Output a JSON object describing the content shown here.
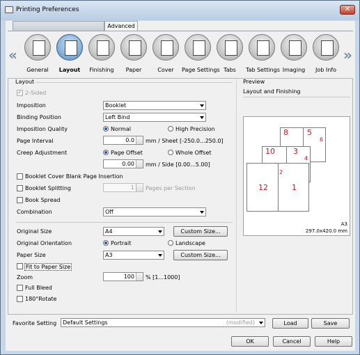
{
  "window": {
    "title": "Printing Preferences",
    "close_glyph": "✕"
  },
  "tabs": {
    "advanced": "Advanced"
  },
  "features": [
    {
      "label": "General",
      "icon": "printer-icon"
    },
    {
      "label": "Layout",
      "icon": "layout-icon"
    },
    {
      "label": "Finishing",
      "icon": "finishing-icon"
    },
    {
      "label": "Paper",
      "icon": "paper-icon"
    },
    {
      "label": "Cover",
      "icon": "cover-icon"
    },
    {
      "label": "Page Settings",
      "icon": "page-settings-icon"
    },
    {
      "label": "Tabs",
      "icon": "tabs-icon"
    },
    {
      "label": "Tab Settings",
      "icon": "tab-settings-icon"
    },
    {
      "label": "Imaging",
      "icon": "imaging-icon"
    },
    {
      "label": "Job Info",
      "icon": "job-info-icon"
    }
  ],
  "layout": {
    "group_title": "Layout",
    "two_sided": "2-Sided",
    "imposition_label": "Imposition",
    "imposition_value": "Booklet",
    "binding_label": "Binding Position",
    "binding_value": "Left Bind",
    "quality_label": "Imposition Quality",
    "quality_normal": "Normal",
    "quality_high": "High Precision",
    "page_interval_label": "Page Interval",
    "page_interval_value": "0.0",
    "page_interval_unit": "mm / Sheet [-250.0...250.0]",
    "creep_label": "Creep Adjustment",
    "creep_page_offset": "Page Offset",
    "creep_whole_offset": "Whole Offset",
    "creep_value": "0.00",
    "creep_unit": "mm / Side [0.00...5.00]",
    "booklet_cover": "Booklet Cover Blank Page Insertion",
    "booklet_split": "Booklet Splitting",
    "split_value": "1",
    "split_unit": "Pages per Section",
    "book_spread": "Book Spread",
    "combination_label": "Combination",
    "combination_value": "Off",
    "orig_size_label": "Original Size",
    "orig_size_value": "A4",
    "custom_size": "Custom Size...",
    "orientation_label": "Original Orientation",
    "portrait": "Portrait",
    "landscape": "Landscape",
    "paper_size_label": "Paper Size",
    "paper_size_value": "A3",
    "fit_to_paper": "Fit to Paper Size",
    "zoom_label": "Zoom",
    "zoom_value": "100",
    "zoom_unit": "% [1...1000]",
    "full_bleed": "Full Bleed",
    "rotate": "180°Rotate"
  },
  "preview": {
    "group_title": "Preview",
    "subtitle": "Layout and Finishing",
    "paper": "A3",
    "dims": "297.0x420.0 mm",
    "page_numbers": [
      "8",
      "5",
      "6",
      "10",
      "3",
      "4",
      "12",
      "1",
      "2"
    ]
  },
  "favorite": {
    "label": "Favorite Setting",
    "value": "Default Settings",
    "status": "(modified)",
    "load": "Load",
    "save": "Save"
  },
  "buttons": {
    "ok": "OK",
    "cancel": "Cancel",
    "help": "Help"
  },
  "colors": {
    "accent": "#2c5a9e",
    "page_number": "#b1202a"
  }
}
